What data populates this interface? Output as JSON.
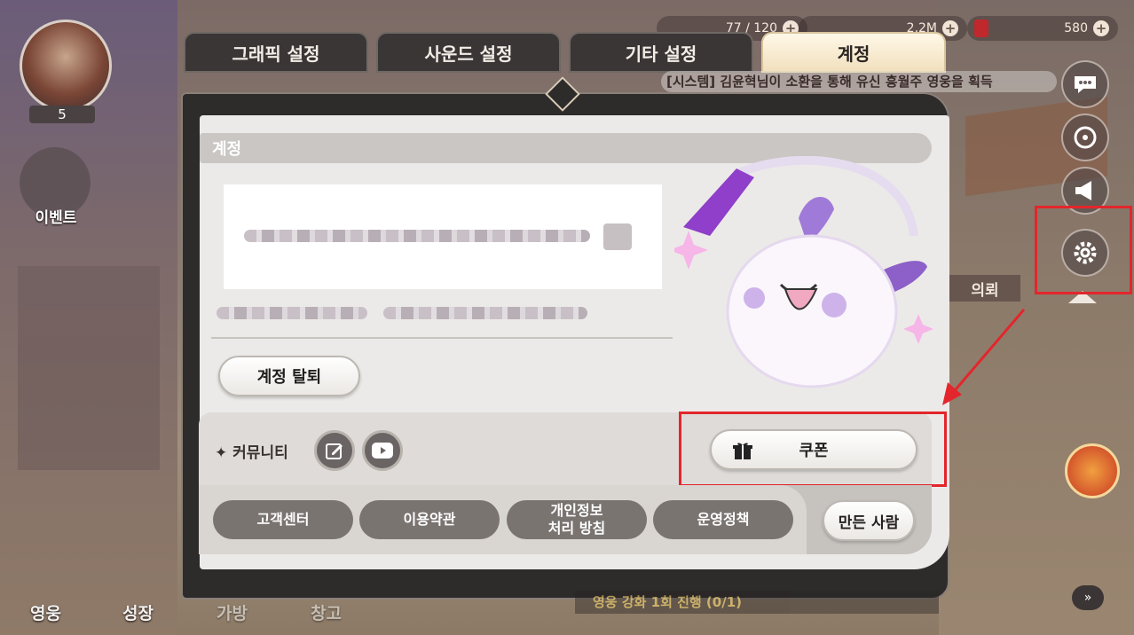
{
  "hud": {
    "stamina": "77 / 120",
    "gold": "2.2M",
    "gems": "580"
  },
  "player": {
    "level": "5",
    "event_label": "이벤트"
  },
  "chat_ticker": "[시스템] 김윤혁님이 소환을 통해 유신 흥월주 영웅을 획득",
  "bottom_nav": [
    "영웅",
    "성장",
    "가방",
    "창고"
  ],
  "side_right_label": "의뢰",
  "tabs": [
    "그래픽 설정",
    "사운드 설정",
    "기타 설정",
    "계정"
  ],
  "active_tab": "계정",
  "panel": {
    "section_title": "계정",
    "withdraw_button": "계정 탈퇴",
    "community_label": "커뮤니티",
    "coupon_button": "쿠폰",
    "footer_buttons": [
      "고객센터",
      "이용약관",
      "개인정보\n처리 방침",
      "운영정책"
    ],
    "credits_button": "만든 사람"
  },
  "quest_ticker": "영웅 강화 1회 진행 (0/1)",
  "colors": {
    "highlight_box": "#e3262c",
    "active_tab": "#f1e0be",
    "panel_dark": "#2e2b2b"
  }
}
